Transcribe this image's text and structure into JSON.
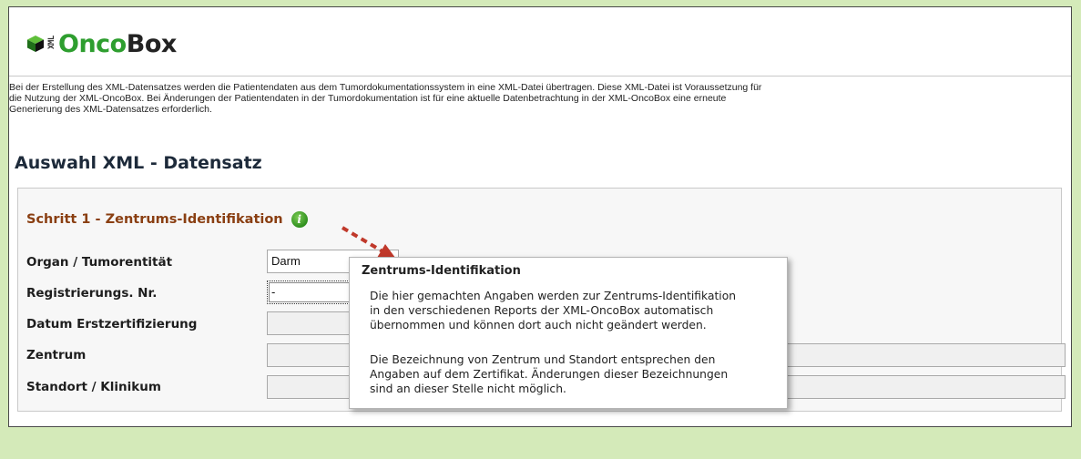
{
  "logo": {
    "xml": "XML",
    "onco": "Onco",
    "box": "Box",
    "brand_green": "#2e9e2f"
  },
  "intro": {
    "line1": "Bei der Erstellung des XML-Datensatzes werden die Patientendaten aus dem Tumordokumentationssystem in eine XML-Datei übertragen. Diese XML-Datei ist Voraussetzung für",
    "line2": "die Nutzung der XML-OncoBox.  Bei Änderungen der Patientendaten in der Tumordokumentation ist für eine aktuelle Datenbetrachtung in der XML-OncoBox eine erneute",
    "line3": "Generierung des XML-Datensatzes erforderlich."
  },
  "page_title": "Auswahl XML - Datensatz",
  "step": {
    "title": "Schritt 1 - Zentrums-Identifikation",
    "info_icon": "info-icon"
  },
  "form": {
    "organ_label": "Organ / Tumorentität",
    "organ_value": "Darm",
    "registrierung_label": "Registrierungs. Nr.",
    "registrierung_value": "-",
    "datum_label": "Datum Erstzertifizierung",
    "datum_value": "",
    "zentrum_label": "Zentrum",
    "zentrum_value": "",
    "standort_label": "Standort / Klinikum",
    "standort_value": ""
  },
  "tooltip": {
    "title": "Zentrums-Identifikation",
    "p1_line1": "Die hier gemachten Angaben werden zur Zentrums-Identifikation",
    "p1_line2": "in den verschiedenen Reports der XML-OncoBox automatisch",
    "p1_line3": "übernommen und können dort auch nicht geändert werden.",
    "p2_line1": "Die Bezeichnung von Zentrum und Standort entsprechen den",
    "p2_line2": "Angaben auf dem Zertifikat. Änderungen dieser Bezeichnungen",
    "p2_line3": "sind an dieser Stelle nicht möglich."
  },
  "colors": {
    "background": "#d4eab9",
    "step_title": "#8a3f12",
    "arrow": "#c0392b"
  }
}
